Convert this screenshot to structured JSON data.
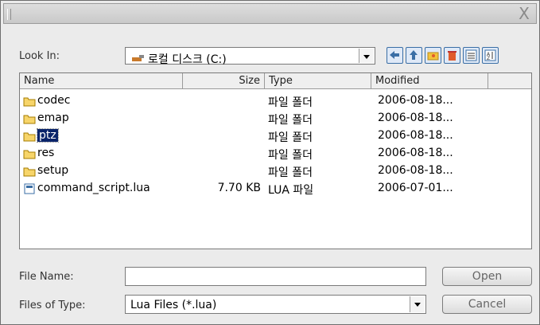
{
  "dialog": {
    "close_glyph": "X"
  },
  "look_in": {
    "label": "Look In:",
    "value": "로컬 디스크 (C:)",
    "icon": "drive-icon"
  },
  "toolbar": [
    {
      "name": "back-icon"
    },
    {
      "name": "up-folder-icon"
    },
    {
      "name": "new-folder-icon"
    },
    {
      "name": "delete-icon"
    },
    {
      "name": "list-view-icon"
    },
    {
      "name": "details-view-icon"
    }
  ],
  "columns": {
    "name": "Name",
    "size": "Size",
    "type": "Type",
    "modified": "Modified"
  },
  "files": [
    {
      "name": "codec",
      "size": "",
      "type": "파일 폴더",
      "modified": "2006-08-18...",
      "icon": "folder-icon",
      "selected": false
    },
    {
      "name": "emap",
      "size": "",
      "type": "파일 폴더",
      "modified": "2006-08-18...",
      "icon": "folder-icon",
      "selected": false
    },
    {
      "name": "ptz",
      "size": "",
      "type": "파일 폴더",
      "modified": "2006-08-18...",
      "icon": "folder-icon",
      "selected": true
    },
    {
      "name": "res",
      "size": "",
      "type": "파일 폴더",
      "modified": "2006-08-18...",
      "icon": "folder-icon",
      "selected": false
    },
    {
      "name": "setup",
      "size": "",
      "type": "파일 폴더",
      "modified": "2006-08-18...",
      "icon": "folder-icon",
      "selected": false
    },
    {
      "name": "command_script.lua",
      "size": "7.70 KB",
      "type": "LUA 파일",
      "modified": "2006-07-01...",
      "icon": "file-icon",
      "selected": false
    }
  ],
  "file_name": {
    "label": "File Name:",
    "value": ""
  },
  "file_type": {
    "label": "Files of Type:",
    "value": "Lua Files (*.lua)"
  },
  "buttons": {
    "open": "Open",
    "cancel": "Cancel"
  },
  "colors": {
    "selection": "#0a246a",
    "folder": "#f3c23b",
    "accent": "#3a6ea5"
  }
}
